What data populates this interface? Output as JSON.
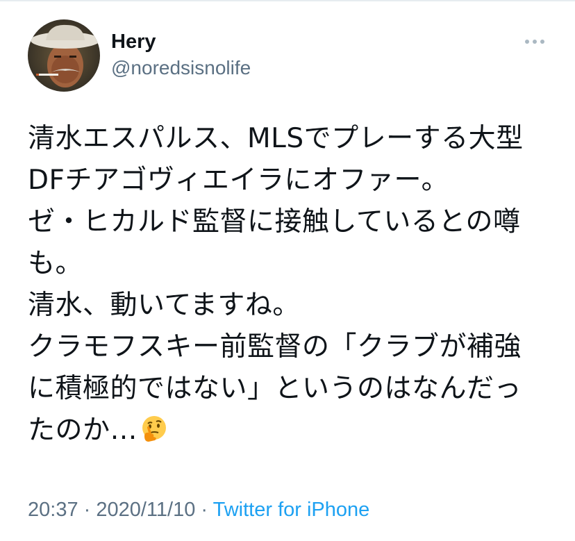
{
  "author": {
    "name": "Hery",
    "handle": "@noredsisnolife"
  },
  "tweet": {
    "lines": [
      "清水エスパルス、MLSでプレーする大型",
      "DFチアゴヴィエイラにオファー。",
      "ゼ・ヒカルド監督に接触しているとの噂",
      "も。",
      "清水、動いてますね。",
      "クラモフスキー前監督の「クラブが補強",
      "に積極的ではない」というのはなんだっ",
      "たのか…"
    ],
    "emoji": "thinking-face-icon"
  },
  "meta": {
    "time": "20:37",
    "separator": " · ",
    "date": "2020/11/10",
    "source": "Twitter for iPhone"
  },
  "colors": {
    "text": "#0f1419",
    "secondary": "#5b7083",
    "link": "#1da1f2"
  }
}
